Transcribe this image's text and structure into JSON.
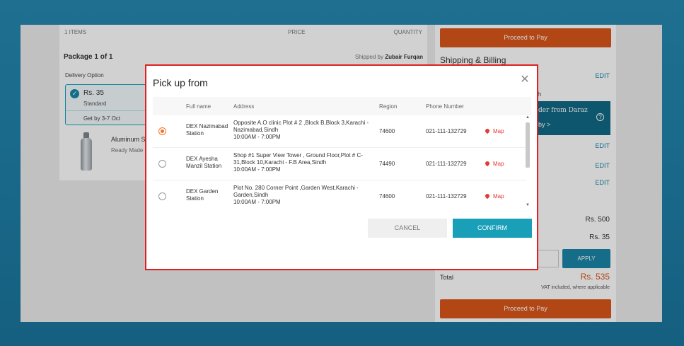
{
  "cart": {
    "items_label": "1 ITEMS",
    "price_label": "PRICE",
    "quantity_label": "QUANTITY",
    "package_title": "Package 1 of 1",
    "shipped_by_prefix": "Shipped by",
    "shipped_by_name": "Zubair Furqan",
    "delivery_option_label": "Delivery Option",
    "delivery_price": "Rs. 35",
    "delivery_type": "Standard",
    "delivery_eta": "Get by 3-7 Oct",
    "product_name": "Aluminum S",
    "product_sub": "Ready Made"
  },
  "summary": {
    "proceed_label": "Proceed to Pay",
    "shipping_title": "Shipping & Billing",
    "edit_label": "EDIT",
    "address_fragment": "dh",
    "banner_line1": "der from Daraz",
    "banner_line2": "by >",
    "banner_help": "?",
    "subtotal": "Rs. 500",
    "shipping_fee": "Rs. 35",
    "apply_label": "APPLY",
    "total_label": "Total",
    "total_amount": "Rs. 535",
    "vat_note": "VAT included, where applicable"
  },
  "modal": {
    "title": "Pick up from",
    "close_glyph": "✕",
    "columns": [
      "Full name",
      "Address",
      "Region",
      "Phone Number"
    ],
    "rows": [
      {
        "selected": true,
        "name": "DEX Nazimabad Station",
        "address": "Opposite A.O clinic Plot # 2 ,Block B,Block 3,Karachi - Nazimabad,Sindh",
        "hours": "10:00AM - 7:00PM",
        "region": "74600",
        "phone": "021-111-132729",
        "map_label": "Map"
      },
      {
        "selected": false,
        "name": "DEX Ayesha Manzil Station",
        "address": "Shop #1 Super View Tower , Ground Floor,Plot # C-31,Block 10,Karachi - F.B Area,Sindh",
        "hours": "10:00AM - 7:00PM",
        "region": "74490",
        "phone": "021-111-132729",
        "map_label": "Map"
      },
      {
        "selected": false,
        "name": "DEX Garden Station",
        "address": "Plot No. 280 Corner Point ,Garden West,Karachi - Garden,Sindh",
        "hours": "10:00AM - 7:00PM",
        "region": "74600",
        "phone": "021-111-132729",
        "map_label": "Map"
      }
    ],
    "cancel_label": "CANCEL",
    "confirm_label": "CONFIRM"
  },
  "colors": {
    "accent_orange": "#d9561a",
    "accent_teal": "#1a9fb8",
    "highlight_border": "#e02020"
  }
}
